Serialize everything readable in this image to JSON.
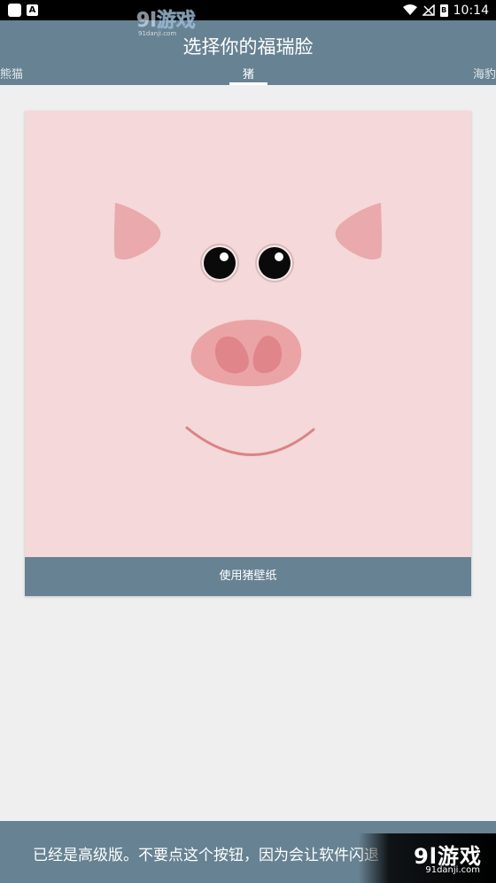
{
  "status_bar": {
    "time": "10:14",
    "battery_label": "B",
    "notif_icon_label": "A"
  },
  "watermark": {
    "logo": "9l游戏",
    "url": "91danji.com"
  },
  "header": {
    "title": "选择你的福瑞脸",
    "tabs": [
      {
        "label": "熊猫"
      },
      {
        "label": "猪"
      },
      {
        "label": "海豹"
      }
    ],
    "selected_tab": 1
  },
  "card": {
    "face": "pig",
    "button_label": "使用猪壁纸"
  },
  "bottom_bar": {
    "text": "已经是高级版。不要点这个按钮，因为会让软件闪退"
  },
  "colors": {
    "primary": "#678292",
    "pig_background": "#f5d8d9",
    "pig_ear": "#e9a9ad",
    "pig_nose": "#eaa4a6",
    "pig_nostril": "#e0858a",
    "smile": "#d98487"
  }
}
